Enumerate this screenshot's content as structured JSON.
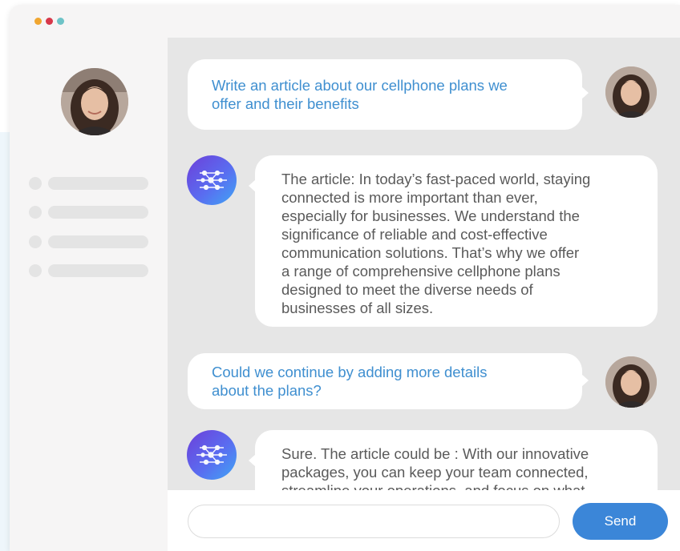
{
  "window": {
    "dots": [
      "#f0a630",
      "#d7384a",
      "#6ec3c7"
    ]
  },
  "sidebar": {
    "avatar_icon": "user-photo-avatar",
    "placeholder_rows": 4
  },
  "messages": [
    {
      "role": "user",
      "lines": [
        "Write an article about our cellphone plans we",
        "offer and their benefits"
      ],
      "avatar_icon": "user-photo-avatar"
    },
    {
      "role": "assistant",
      "lines": [
        "The article: In today’s fast-paced world, staying",
        "connected is more important than ever,",
        "especially for businesses. We understand the",
        "significance of reliable and cost-effective",
        "communication solutions. That’s why we offer",
        "a range of comprehensive cellphone plans",
        "designed to meet the diverse needs of",
        "businesses of all sizes."
      ],
      "avatar_icon": "ai-network-icon"
    },
    {
      "role": "user",
      "lines": [
        "Could we continue by adding more details",
        "about the plans?"
      ],
      "avatar_icon": "user-photo-avatar"
    },
    {
      "role": "assistant",
      "lines": [
        "Sure. The article could be : With our innovative",
        "packages, you can keep your team connected,",
        "streamline your operations, and focus on what"
      ],
      "avatar_icon": "ai-network-icon"
    }
  ],
  "composer": {
    "placeholder": "",
    "send_label": "Send"
  },
  "colors": {
    "user_text": "#3f8fd0",
    "bot_text": "#5a5a5a",
    "send_button": "#3b86d8",
    "chat_background": "#e6e6e6"
  }
}
